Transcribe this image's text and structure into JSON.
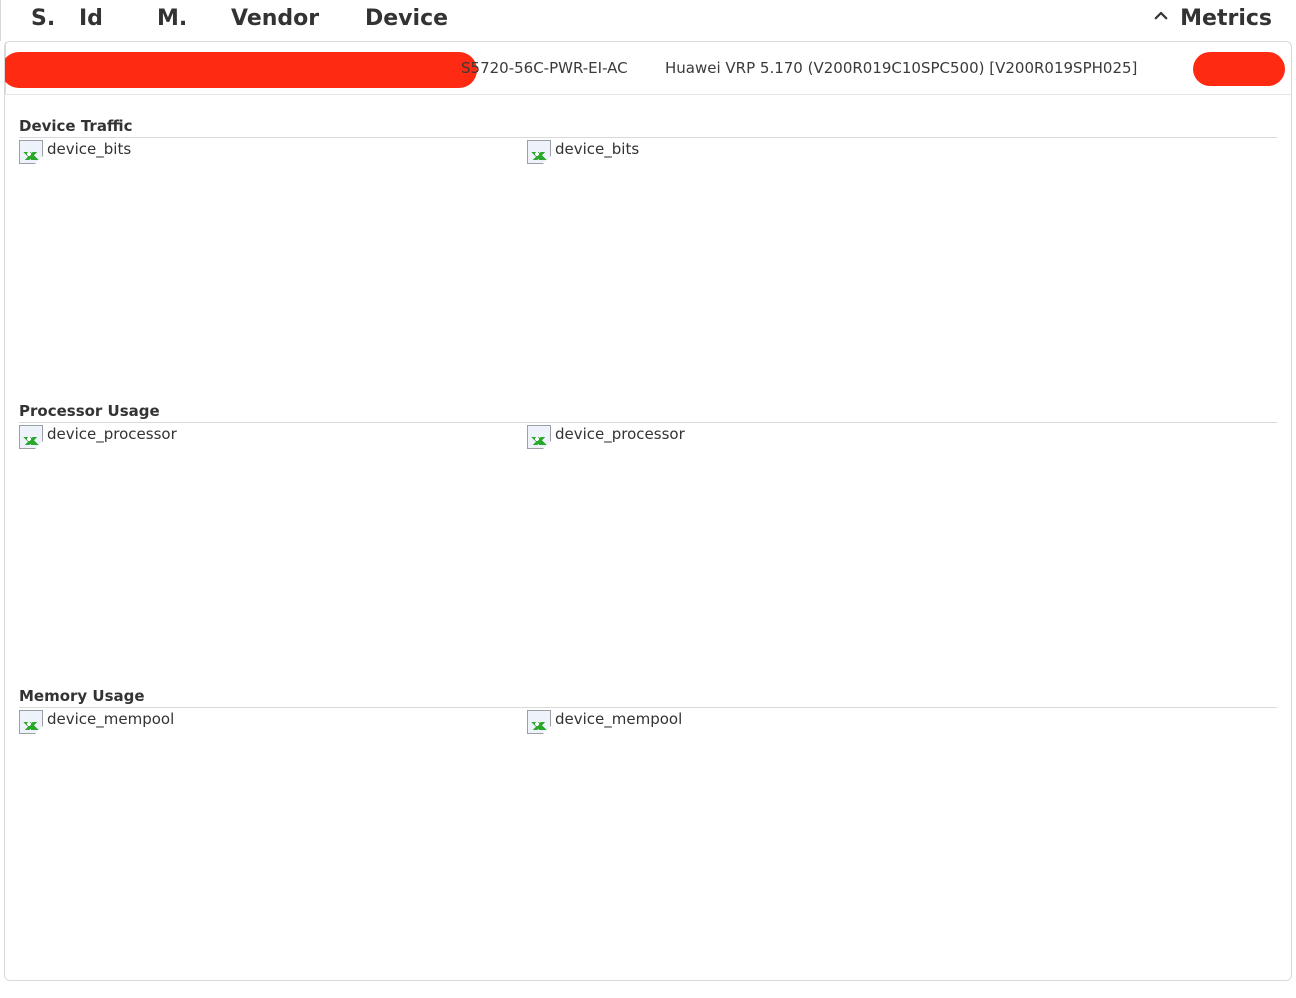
{
  "header": {
    "cols": {
      "s": "S.",
      "id": "Id",
      "m": "M.",
      "vendor": "Vendor",
      "device": "Device",
      "metrics": "Metrics"
    }
  },
  "device_row": {
    "model": "S5720-56C-PWR-EI-AC",
    "firmware": "Huawei VRP 5.170 (V200R019C10SPC500) [V200R019SPH025]"
  },
  "sections": {
    "traffic": {
      "title": "Device Traffic",
      "graph_alt": "device_bits"
    },
    "processor": {
      "title": "Processor Usage",
      "graph_alt": "device_processor"
    },
    "memory": {
      "title": "Memory Usage",
      "graph_alt": "device_mempool"
    }
  }
}
